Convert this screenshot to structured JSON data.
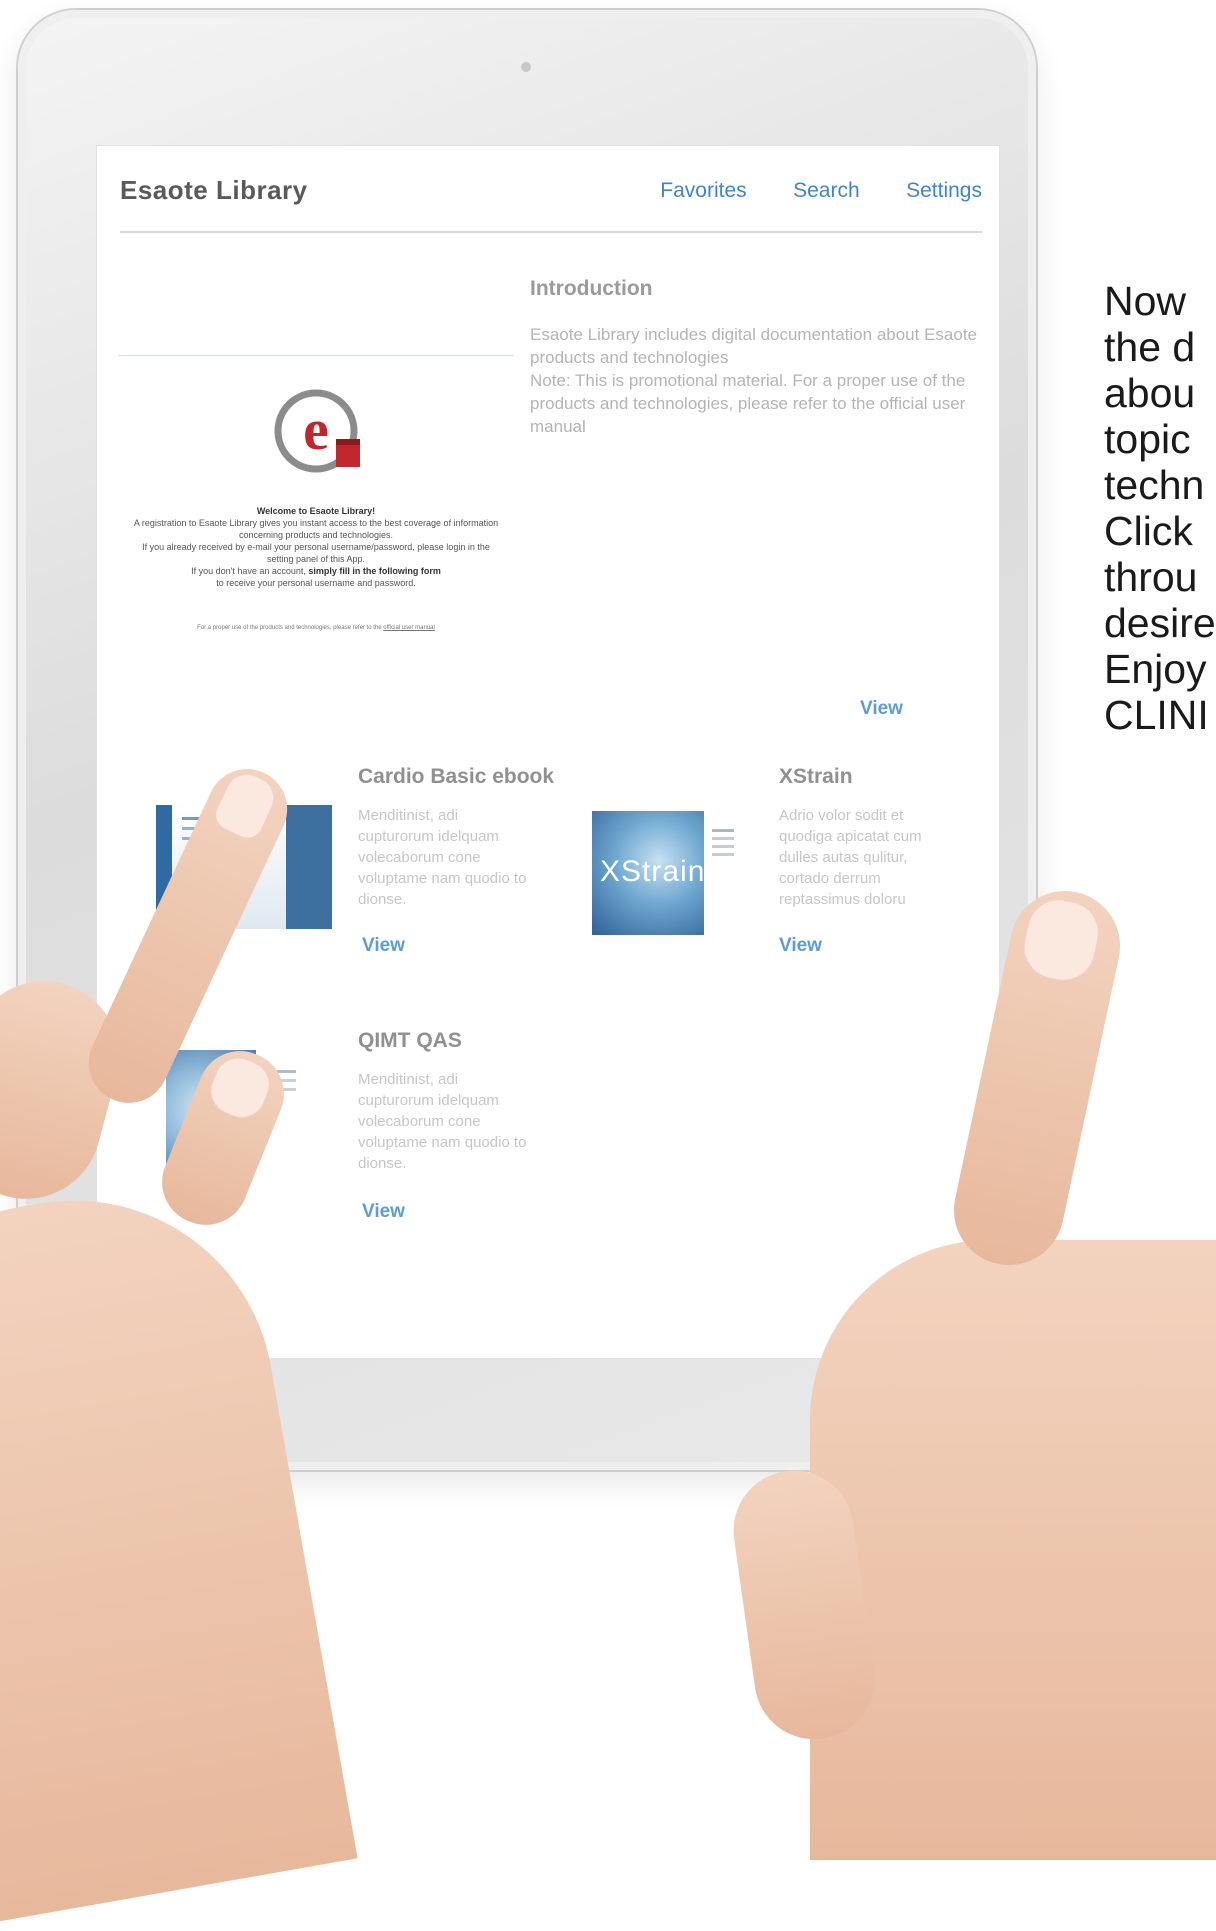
{
  "app": {
    "logo": "Esaote Library",
    "nav": [
      "Favorites",
      "Search",
      "Settings"
    ]
  },
  "welcome": {
    "heading": "Welcome to Esaote Library!",
    "line1": "A registration to Esaote Library gives you instant access to the best coverage of information concerning products and technologies.",
    "line2": "If you already received by e-mail your personal username/password, please login in the setting panel of this App.",
    "line3_prefix": "If you don't have an account, ",
    "line3_bold": "simply fill in the following form",
    "line4": "to receive your personal username and password.",
    "footer_prefix": "For a proper use of the products and technologies, please refer to the ",
    "footer_link": "official user manual"
  },
  "intro": {
    "title": "Introduction",
    "text": "Esaote Library includes digital documentation about Esaote products and technologies\nNote: This is promotional material. For a proper use of the products and technologies, please refer to the official user manual",
    "view": "View"
  },
  "cards": [
    {
      "title": "Cardio Basic ebook",
      "desc": "Menditinist, adi cupturorum idelquam volecaborum cone voluptame nam quodio to dionse.",
      "view": "View"
    },
    {
      "title": "XStrain",
      "desc": "Adrio volor sodit et quodiga apicatat cum dulles autas qulitur, cortado derrum reptassimus doloru",
      "view": "View",
      "cover_label": "XStrain"
    },
    {
      "title": "QIMT QAS",
      "desc": "Menditinist, adi cupturorum idelquam volecaborum cone voluptame nam quodio to dionse.",
      "view": "View"
    }
  ],
  "side_text": [
    "Now",
    "the d",
    "abou",
    "topic",
    "techn",
    "Click",
    "throu",
    "desire",
    "Enjoy",
    "CLINI"
  ]
}
